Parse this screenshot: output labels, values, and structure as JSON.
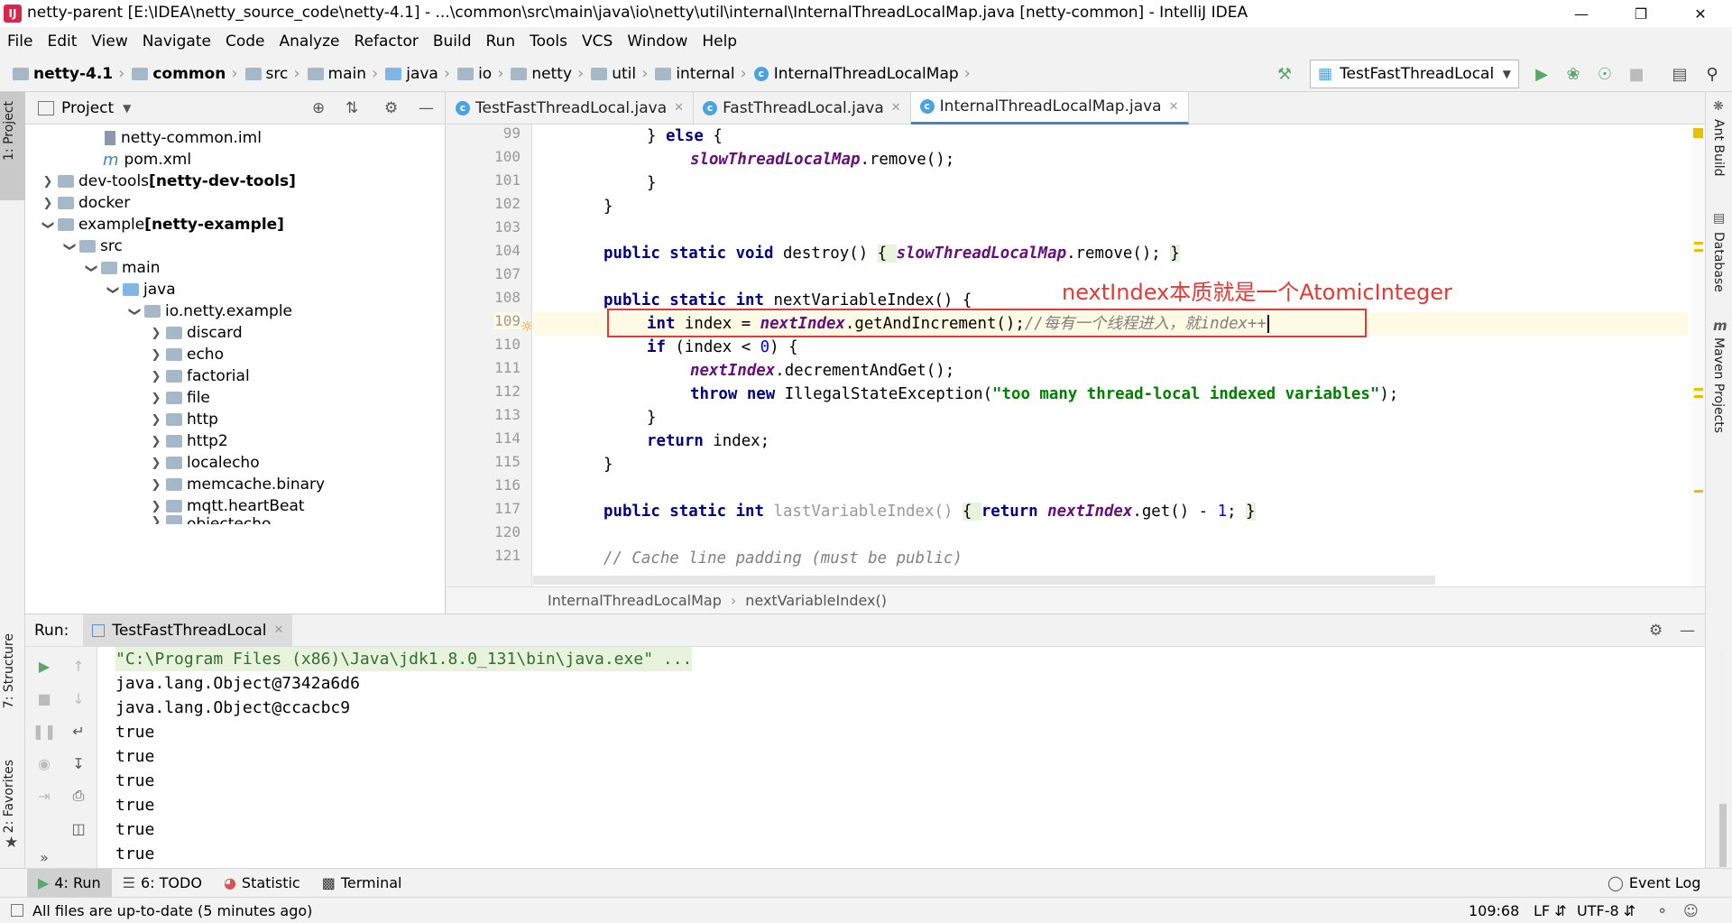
{
  "window": {
    "title": "netty-parent [E:\\IDEA\\netty_source_code\\netty-4.1] - ...\\common\\src\\main\\java\\io\\netty\\util\\internal\\InternalThreadLocalMap.java [netty-common] - IntelliJ IDEA"
  },
  "menu": [
    "File",
    "Edit",
    "View",
    "Navigate",
    "Code",
    "Analyze",
    "Refactor",
    "Build",
    "Run",
    "Tools",
    "VCS",
    "Window",
    "Help"
  ],
  "breadcrumbs": [
    "netty-4.1",
    "common",
    "src",
    "main",
    "java",
    "io",
    "netty",
    "util",
    "internal",
    "InternalThreadLocalMap"
  ],
  "run_config": "TestFastThreadLocal",
  "project_panel": {
    "title": "Project",
    "items": [
      {
        "label": "netty-common.iml",
        "bold": ""
      },
      {
        "label": "pom.xml",
        "bold": ""
      },
      {
        "label": "dev-tools ",
        "bold": "[netty-dev-tools]"
      },
      {
        "label": "docker",
        "bold": ""
      },
      {
        "label": "example ",
        "bold": "[netty-example]"
      },
      {
        "label": "src",
        "bold": ""
      },
      {
        "label": "main",
        "bold": ""
      },
      {
        "label": "java",
        "bold": ""
      },
      {
        "label": "io.netty.example",
        "bold": ""
      },
      {
        "label": "discard",
        "bold": ""
      },
      {
        "label": "echo",
        "bold": ""
      },
      {
        "label": "factorial",
        "bold": ""
      },
      {
        "label": "file",
        "bold": ""
      },
      {
        "label": "http",
        "bold": ""
      },
      {
        "label": "http2",
        "bold": ""
      },
      {
        "label": "localecho",
        "bold": ""
      },
      {
        "label": "memcache.binary",
        "bold": ""
      },
      {
        "label": "mqtt.heartBeat",
        "bold": ""
      },
      {
        "label": "objectecho",
        "bold": ""
      }
    ]
  },
  "editor": {
    "tabs": [
      "TestFastThreadLocal.java",
      "FastThreadLocal.java",
      "InternalThreadLocalMap.java"
    ],
    "line_numbers": [
      "99",
      "100",
      "101",
      "102",
      "103",
      "104",
      "107",
      "108",
      "109",
      "110",
      "111",
      "112",
      "113",
      "114",
      "115",
      "116",
      "117",
      "120",
      "121"
    ],
    "annotation": "nextIndex本质就是一个AtomicInteger",
    "comment_109": "//每有一个线程进入，就index++",
    "crumbs": [
      "InternalThreadLocalMap",
      "nextVariableIndex()"
    ]
  },
  "code": {
    "l99": [
      "} ",
      "else",
      " {"
    ],
    "l100": [
      "slowThreadLocalMap",
      ".remove();"
    ],
    "l101": "}",
    "l102": "}",
    "l104": [
      "public static void",
      " destroy() ",
      "{ ",
      "slowThreadLocalMap",
      ".remove(); ",
      "}"
    ],
    "l108": [
      "public static int",
      " nextVariableIndex() {"
    ],
    "l109": [
      "int",
      " index = ",
      "nextIndex",
      ".getAndIncrement();"
    ],
    "l110": [
      "if",
      " (index < ",
      "0",
      ") {"
    ],
    "l111": [
      "nextIndex",
      ".decrementAndGet();"
    ],
    "l112": [
      "throw new",
      " IllegalStateException(",
      "\"too many thread-local indexed variables\"",
      ");"
    ],
    "l113": "}",
    "l114": [
      "return",
      " index;"
    ],
    "l115": "}",
    "l117": [
      "public static int",
      " lastVariableIndex() ",
      "{ ",
      "return ",
      "nextIndex",
      ".get() - ",
      "1",
      "; ",
      "}"
    ],
    "l121": "// Cache line padding (must be public)"
  },
  "run": {
    "label": "Run:",
    "tab": "TestFastThreadLocal",
    "console": [
      "\"C:\\Program Files (x86)\\Java\\jdk1.8.0_131\\bin\\java.exe\" ...",
      "java.lang.Object@7342a6d6",
      "java.lang.Object@ccacbc9",
      "true",
      "true",
      "true",
      "true",
      "true",
      "true"
    ]
  },
  "left_tools": [
    "1: Project",
    "7: Structure",
    "2: Favorites"
  ],
  "right_tools": [
    "Ant Build",
    "Database",
    "Maven Projects"
  ],
  "bottom_tabs": [
    "4: Run",
    "6: TODO",
    "Statistic",
    "Terminal"
  ],
  "event_log": "Event Log",
  "status": {
    "message": "All files are up-to-date (5 minutes ago)",
    "position": "109:68",
    "line_sep": "LF",
    "encoding": "UTF-8"
  },
  "colors": {
    "accent": "#4083c9",
    "annotation": "#e53935",
    "run_green": "#59a869"
  }
}
